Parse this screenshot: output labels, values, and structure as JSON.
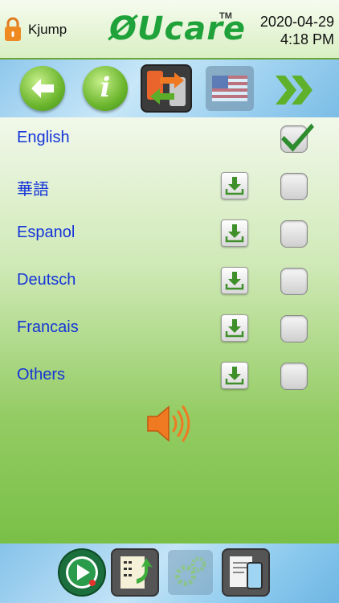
{
  "header": {
    "user": "Kjump",
    "brand": "ØUcare",
    "trademark": "TM",
    "date": "2020-04-29",
    "time": "4:18 PM"
  },
  "toolbar": {
    "back": "back-arrow-icon",
    "info": "i",
    "sync": "language-sync-icon",
    "flag": "us-flag-icon",
    "next": "double-chevron-right-icon"
  },
  "languages": [
    {
      "label": "English",
      "checked": true,
      "downloadable": false
    },
    {
      "label": "華語",
      "checked": false,
      "downloadable": true
    },
    {
      "label": "Espanol",
      "checked": false,
      "downloadable": true
    },
    {
      "label": "Deutsch",
      "checked": false,
      "downloadable": true
    },
    {
      "label": "Francais",
      "checked": false,
      "downloadable": true
    },
    {
      "label": "Others",
      "checked": false,
      "downloadable": true
    }
  ],
  "speaker": "speaker-icon",
  "bottom_bar": [
    "play-icon",
    "record-sheet-icon",
    "settings-gears-icon",
    "phone-document-icon"
  ],
  "colors": {
    "brand_green": "#1fa23a",
    "language_text": "#1434d8",
    "speaker_orange": "#f07a22"
  }
}
